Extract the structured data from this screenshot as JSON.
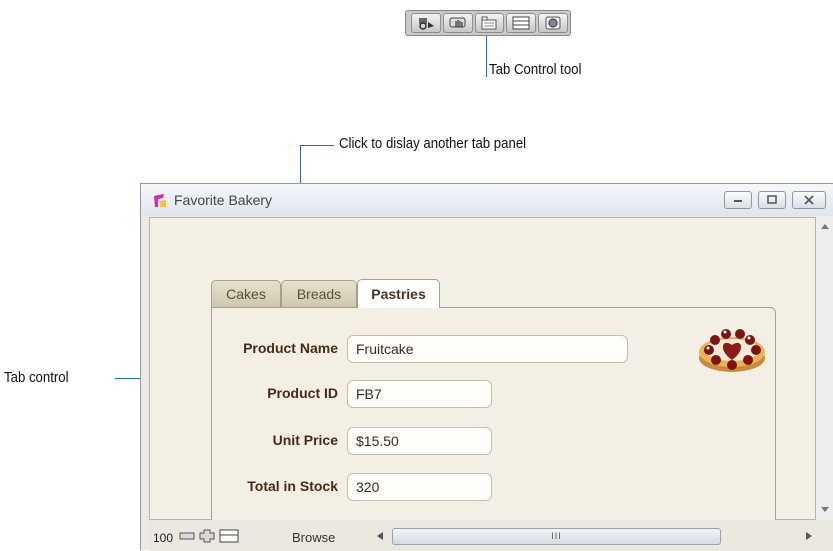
{
  "annotations": {
    "tab_control_tool": "Tab Control tool",
    "click_hint": "Click to dislay another tab panel",
    "tab_control": "Tab control"
  },
  "window": {
    "title": "Favorite Bakery",
    "tabs": [
      {
        "label": "Cakes",
        "active": false
      },
      {
        "label": "Breads",
        "active": false
      },
      {
        "label": "Pastries",
        "active": true
      }
    ],
    "fields": [
      {
        "label": "Product Name",
        "value": "Fruitcake"
      },
      {
        "label": "Product ID",
        "value": "FB7"
      },
      {
        "label": "Unit Price",
        "value": "$15.50"
      },
      {
        "label": "Total in Stock",
        "value": "320"
      }
    ],
    "statusbar": {
      "zoom": "100",
      "mode": "Browse",
      "scroll_grip": "III"
    }
  },
  "toolbar": {
    "icons": [
      "stamp-icon",
      "hand-icon",
      "tab-control-icon",
      "web-viewer-icon",
      "globe-icon"
    ]
  },
  "colors": {
    "callout_line": "#1f6fa8",
    "label_text": "#4a2a16",
    "panel_bg": "#f4efe5"
  }
}
